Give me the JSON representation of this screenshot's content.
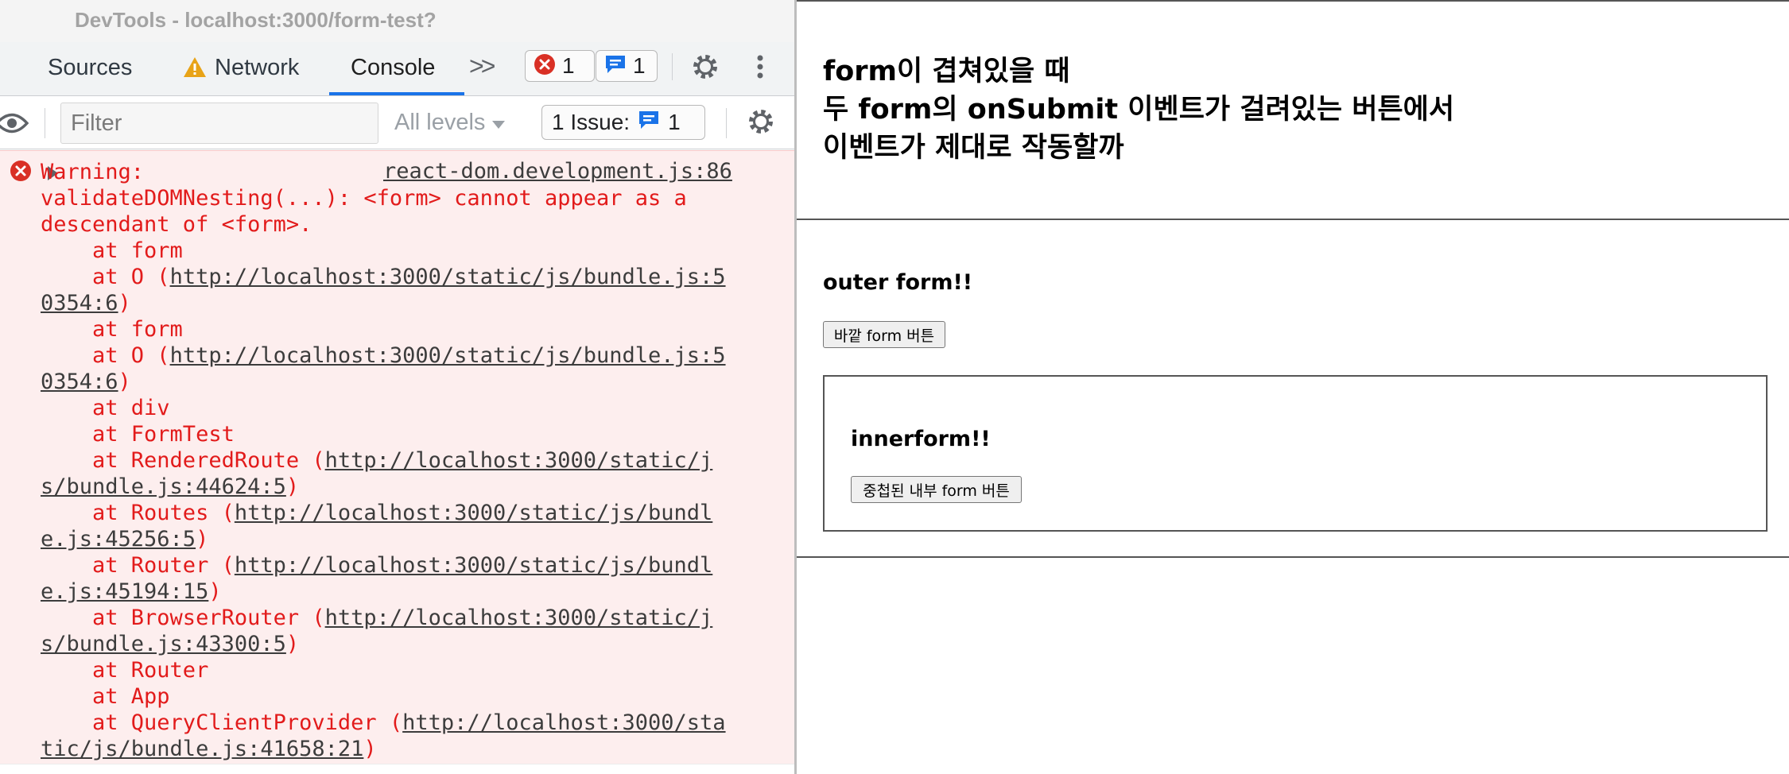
{
  "devtools": {
    "window_title": "DevTools - localhost:3000/form-test?",
    "tabs": [
      {
        "label": "Sources"
      },
      {
        "label": "Network",
        "warning": true
      },
      {
        "label": "Console",
        "active": true
      }
    ],
    "more_tabs_icon": "chevron-double-right-icon",
    "error_count": "1",
    "message_count": "1",
    "filter": {
      "placeholder": "Filter",
      "value": ""
    },
    "levels_label": "All levels",
    "issues": {
      "label": "1 Issue:",
      "count": "1"
    },
    "colors": {
      "accent": "#1a73e8",
      "error_text": "#e21b1b",
      "error_bg": "#fdeeee",
      "error_icon": "#d93025",
      "warning_icon": "#e8a317"
    }
  },
  "console": {
    "entries": [
      {
        "level": "error",
        "source": "react-dom.development.js:86",
        "lines": [
          {
            "text": "Warning:"
          },
          {
            "text": "validateDOMNesting(...): <form> cannot appear as a"
          },
          {
            "text": "descendant of <form>."
          },
          {
            "text": "    at form"
          },
          {
            "prefix": "    at O (",
            "link": "http://localhost:3000/static/js/bundle.js:5"
          },
          {
            "link": "0354:6",
            "suffix": ")"
          },
          {
            "text": "    at form"
          },
          {
            "prefix": "    at O (",
            "link": "http://localhost:3000/static/js/bundle.js:5"
          },
          {
            "link": "0354:6",
            "suffix": ")"
          },
          {
            "text": "    at div"
          },
          {
            "text": "    at FormTest"
          },
          {
            "prefix": "    at RenderedRoute (",
            "link": "http://localhost:3000/static/j"
          },
          {
            "link": "s/bundle.js:44624:5",
            "suffix": ")"
          },
          {
            "prefix": "    at Routes (",
            "link": "http://localhost:3000/static/js/bundl"
          },
          {
            "link": "e.js:45256:5",
            "suffix": ")"
          },
          {
            "prefix": "    at Router (",
            "link": "http://localhost:3000/static/js/bundl"
          },
          {
            "link": "e.js:45194:15",
            "suffix": ")"
          },
          {
            "prefix": "    at BrowserRouter (",
            "link": "http://localhost:3000/static/j"
          },
          {
            "link": "s/bundle.js:43300:5",
            "suffix": ")"
          },
          {
            "text": "    at Router"
          },
          {
            "text": "    at App"
          },
          {
            "prefix": "    at QueryClientProvider (",
            "link": "http://localhost:3000/sta"
          },
          {
            "link": "tic/js/bundle.js:41658:21",
            "suffix": ")"
          }
        ]
      }
    ]
  },
  "page": {
    "heading_lines": [
      "form이 겹쳐있을 때",
      "두 form의 onSubmit 이벤트가 걸려있는 버튼에서",
      "이벤트가 제대로 작동할까"
    ],
    "outer_form": {
      "title": "outer form!!",
      "button_label": "바깥 form 버튼"
    },
    "inner_form": {
      "title": "innerform!!",
      "button_label": "중첩된 내부 form 버튼"
    }
  }
}
